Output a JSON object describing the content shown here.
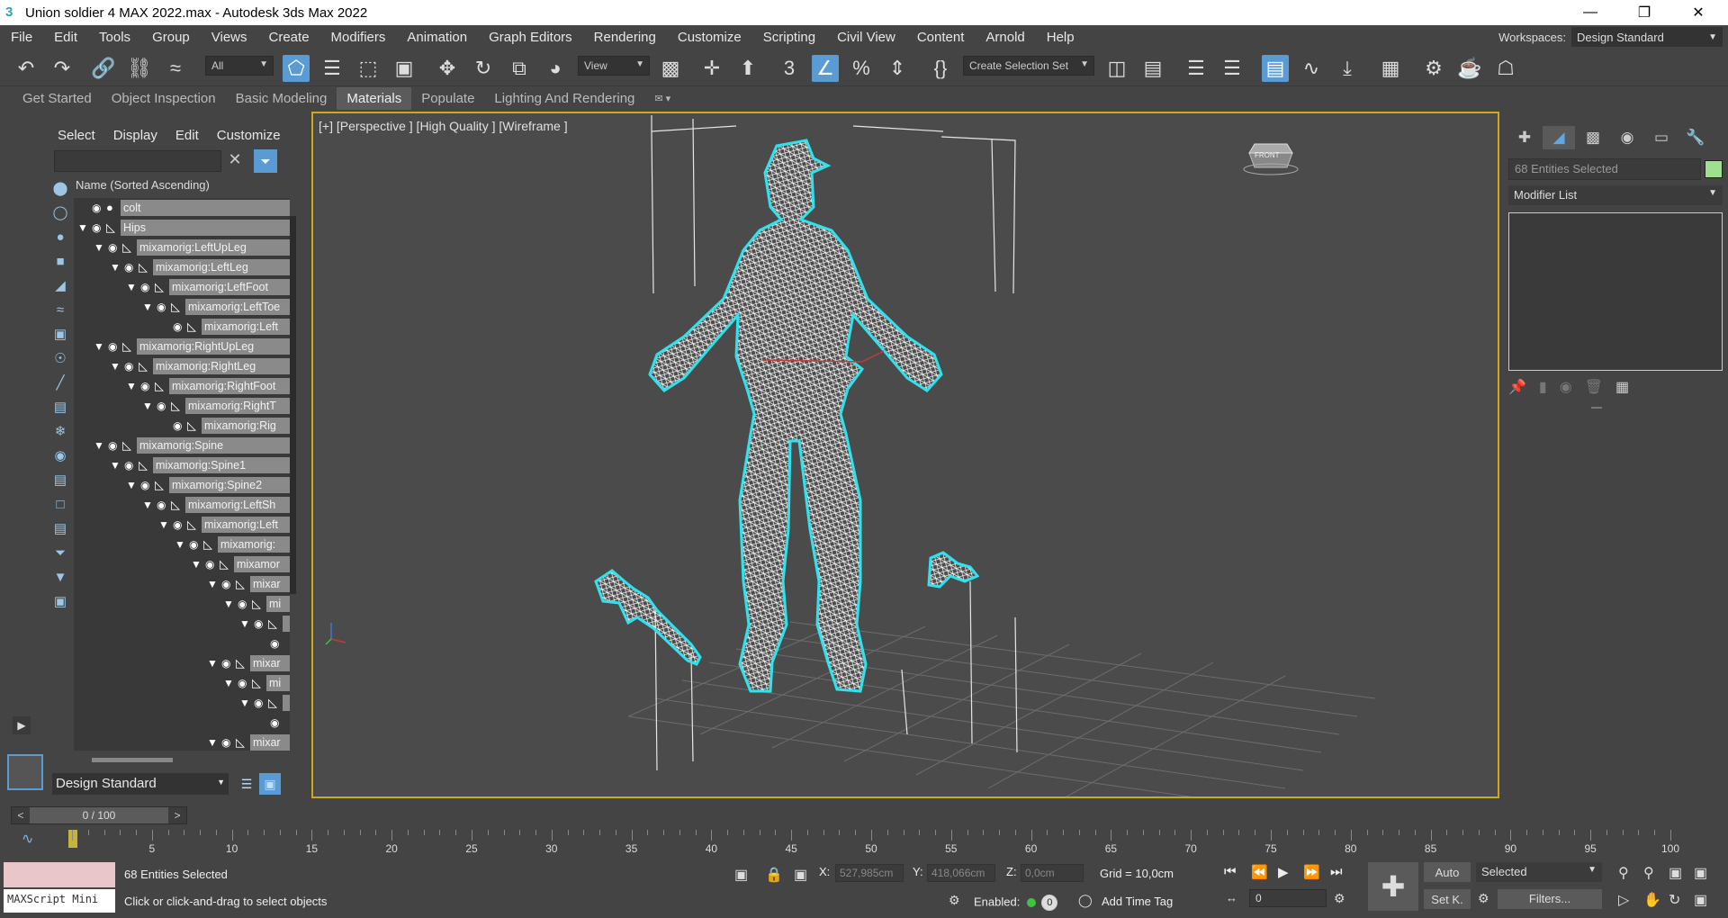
{
  "window": {
    "title": "Union soldier 4 MAX 2022.max - Autodesk 3ds Max 2022",
    "app_icon": "3ds-max-icon"
  },
  "menu": [
    "File",
    "Edit",
    "Tools",
    "Group",
    "Views",
    "Create",
    "Modifiers",
    "Animation",
    "Graph Editors",
    "Rendering",
    "Customize",
    "Scripting",
    "Civil View",
    "Content",
    "Arnold",
    "Help"
  ],
  "workspaces": {
    "label": "Workspaces:",
    "value": "Design Standard"
  },
  "toolbar": {
    "selection_filter": "All",
    "ref_coord": "View",
    "selection_set": "Create Selection Set"
  },
  "ribbon_tabs": [
    "Get Started",
    "Object Inspection",
    "Basic Modeling",
    "Materials",
    "Populate",
    "Lighting And Rendering"
  ],
  "ribbon_active": "Materials",
  "scene_explorer": {
    "menu": [
      "Select",
      "Display",
      "Edit",
      "Customize"
    ],
    "column_header": "Name (Sorted Ascending)",
    "rows": [
      {
        "name": "colt",
        "depth": 0,
        "expand": false,
        "icon": "sphere"
      },
      {
        "name": "Hips",
        "depth": 0,
        "expand": true,
        "icon": "bone"
      },
      {
        "name": "mixamorig:LeftUpLeg",
        "depth": 1,
        "expand": true,
        "icon": "bone"
      },
      {
        "name": "mixamorig:LeftLeg",
        "depth": 2,
        "expand": true,
        "icon": "bone"
      },
      {
        "name": "mixamorig:LeftFoot",
        "depth": 3,
        "expand": true,
        "icon": "bone"
      },
      {
        "name": "mixamorig:LeftToe",
        "depth": 4,
        "expand": true,
        "icon": "bone"
      },
      {
        "name": "mixamorig:Left",
        "depth": 5,
        "expand": false,
        "icon": "bone"
      },
      {
        "name": "mixamorig:RightUpLeg",
        "depth": 1,
        "expand": true,
        "icon": "bone"
      },
      {
        "name": "mixamorig:RightLeg",
        "depth": 2,
        "expand": true,
        "icon": "bone"
      },
      {
        "name": "mixamorig:RightFoot",
        "depth": 3,
        "expand": true,
        "icon": "bone"
      },
      {
        "name": "mixamorig:RightT",
        "depth": 4,
        "expand": true,
        "icon": "bone"
      },
      {
        "name": "mixamorig:Rig",
        "depth": 5,
        "expand": false,
        "icon": "bone"
      },
      {
        "name": "mixamorig:Spine",
        "depth": 1,
        "expand": true,
        "icon": "bone"
      },
      {
        "name": "mixamorig:Spine1",
        "depth": 2,
        "expand": true,
        "icon": "bone"
      },
      {
        "name": "mixamorig:Spine2",
        "depth": 3,
        "expand": true,
        "icon": "bone"
      },
      {
        "name": "mixamorig:LeftSh",
        "depth": 4,
        "expand": true,
        "icon": "bone"
      },
      {
        "name": "mixamorig:Left",
        "depth": 5,
        "expand": true,
        "icon": "bone"
      },
      {
        "name": "mixamorig:",
        "depth": 6,
        "expand": true,
        "icon": "bone"
      },
      {
        "name": "mixamor",
        "depth": 7,
        "expand": true,
        "icon": "bone"
      },
      {
        "name": "mixar",
        "depth": 8,
        "expand": true,
        "icon": "bone"
      },
      {
        "name": "mi",
        "depth": 9,
        "expand": true,
        "icon": "bone"
      },
      {
        "name": "",
        "depth": 10,
        "expand": true,
        "icon": "bone"
      },
      {
        "name": "",
        "depth": 11,
        "expand": false,
        "icon": "eye-only"
      },
      {
        "name": "mixar",
        "depth": 8,
        "expand": true,
        "icon": "bone"
      },
      {
        "name": "mi",
        "depth": 9,
        "expand": true,
        "icon": "bone"
      },
      {
        "name": "",
        "depth": 10,
        "expand": true,
        "icon": "bone"
      },
      {
        "name": "",
        "depth": 11,
        "expand": false,
        "icon": "eye-only"
      },
      {
        "name": "mixar",
        "depth": 8,
        "expand": true,
        "icon": "bone"
      }
    ],
    "layer": "Design Standard"
  },
  "viewport": {
    "label": "[+] [Perspective ] [High Quality ] [Wireframe ]",
    "viewcube_text": "FRONT"
  },
  "command_panel": {
    "selection": "68 Entities Selected",
    "modifier_list": "Modifier List",
    "swatch_color": "#9ee08e"
  },
  "timeline": {
    "frame": "0 / 100",
    "ticks": [
      "5",
      "10",
      "15",
      "20",
      "25",
      "30",
      "35",
      "40",
      "45",
      "50",
      "55",
      "60",
      "65",
      "70",
      "75",
      "80",
      "85",
      "90",
      "95",
      "100"
    ]
  },
  "status": {
    "maxscript": "MAXScript Mini",
    "selection": "68 Entities Selected",
    "prompt": "Click or click-and-drag to select objects",
    "x_label": "X:",
    "x_value": "527,985cm",
    "y_label": "Y:",
    "y_value": "418,066cm",
    "z_label": "Z:",
    "z_value": "0,0cm",
    "grid": "Grid = 10,0cm",
    "enabled": "Enabled:",
    "enabled_count": "0",
    "add_time_tag": "Add Time Tag",
    "auto": "Auto",
    "set_key": "Set K.",
    "key_filter": "Selected",
    "filters": "Filters...",
    "current_frame": "0"
  }
}
